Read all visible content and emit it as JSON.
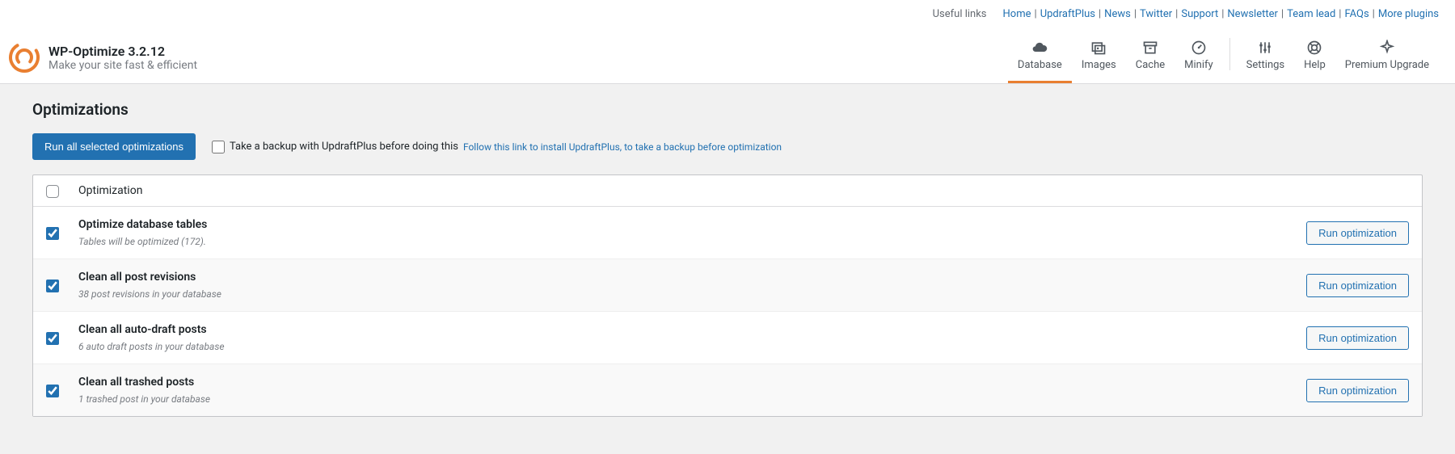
{
  "topbar": {
    "useful_links_label": "Useful links",
    "links": [
      "Home",
      "UpdraftPlus",
      "News",
      "Twitter",
      "Support",
      "Newsletter",
      "Team lead",
      "FAQs",
      "More plugins"
    ]
  },
  "logo": {
    "title": "WP-Optimize 3.2.12",
    "subtitle": "Make your site fast & efficient"
  },
  "nav": {
    "database": "Database",
    "images": "Images",
    "cache": "Cache",
    "minify": "Minify",
    "settings": "Settings",
    "help": "Help",
    "premium": "Premium Upgrade"
  },
  "section": {
    "title": "Optimizations",
    "run_all_btn": "Run all selected optimizations",
    "backup_label": "Take a backup with UpdraftPlus before doing this",
    "backup_link": "Follow this link to install UpdraftPlus, to take a backup before optimization",
    "col_header": "Optimization",
    "run_btn": "Run optimization"
  },
  "optimizations": [
    {
      "title": "Optimize database tables",
      "sub": "Tables will be optimized (172).",
      "checked": true
    },
    {
      "title": "Clean all post revisions",
      "sub": "38 post revisions in your database",
      "checked": true
    },
    {
      "title": "Clean all auto-draft posts",
      "sub": "6 auto draft posts in your database",
      "checked": true
    },
    {
      "title": "Clean all trashed posts",
      "sub": "1 trashed post in your database",
      "checked": true
    }
  ]
}
